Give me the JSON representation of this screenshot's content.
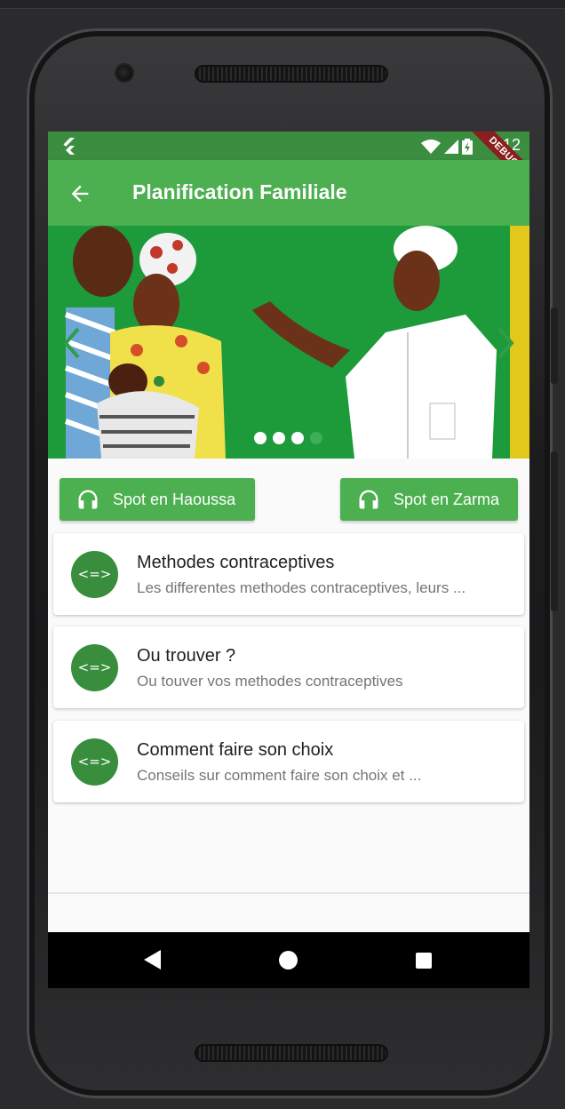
{
  "status_bar": {
    "time": "3:12",
    "debug_label": "DEBUG",
    "icons": [
      "flutter-icon",
      "wifi-icon",
      "signal-icon",
      "battery-icon"
    ]
  },
  "app_bar": {
    "title": "Planification Familiale",
    "back_icon": "arrow-back-icon"
  },
  "carousel": {
    "total_slides": 4,
    "active_slide": 3,
    "prev_icon": "chevron-left-icon",
    "next_icon": "chevron-right-icon"
  },
  "audio_buttons": [
    {
      "label": "Spot en Haoussa",
      "icon": "headphones-icon"
    },
    {
      "label": "Spot en Zarma",
      "icon": "headphones-icon"
    }
  ],
  "topics": [
    {
      "avatar": "<=>",
      "title": "Methodes contraceptives",
      "subtitle": "Les differentes methodes contraceptives, leurs ..."
    },
    {
      "avatar": "<=>",
      "title": "Ou trouver ?",
      "subtitle": "Ou touver vos methodes contraceptives"
    },
    {
      "avatar": "<=>",
      "title": "Comment faire son choix",
      "subtitle": "Conseils sur comment faire son choix et ..."
    }
  ],
  "colors": {
    "primary": "#4caf50",
    "status_bar": "#3b8e40",
    "avatar": "#388e3c",
    "debug_ribbon": "#8b1f1f"
  },
  "nav_bar": {
    "icons": [
      "nav-back-icon",
      "nav-home-icon",
      "nav-recent-icon"
    ]
  }
}
